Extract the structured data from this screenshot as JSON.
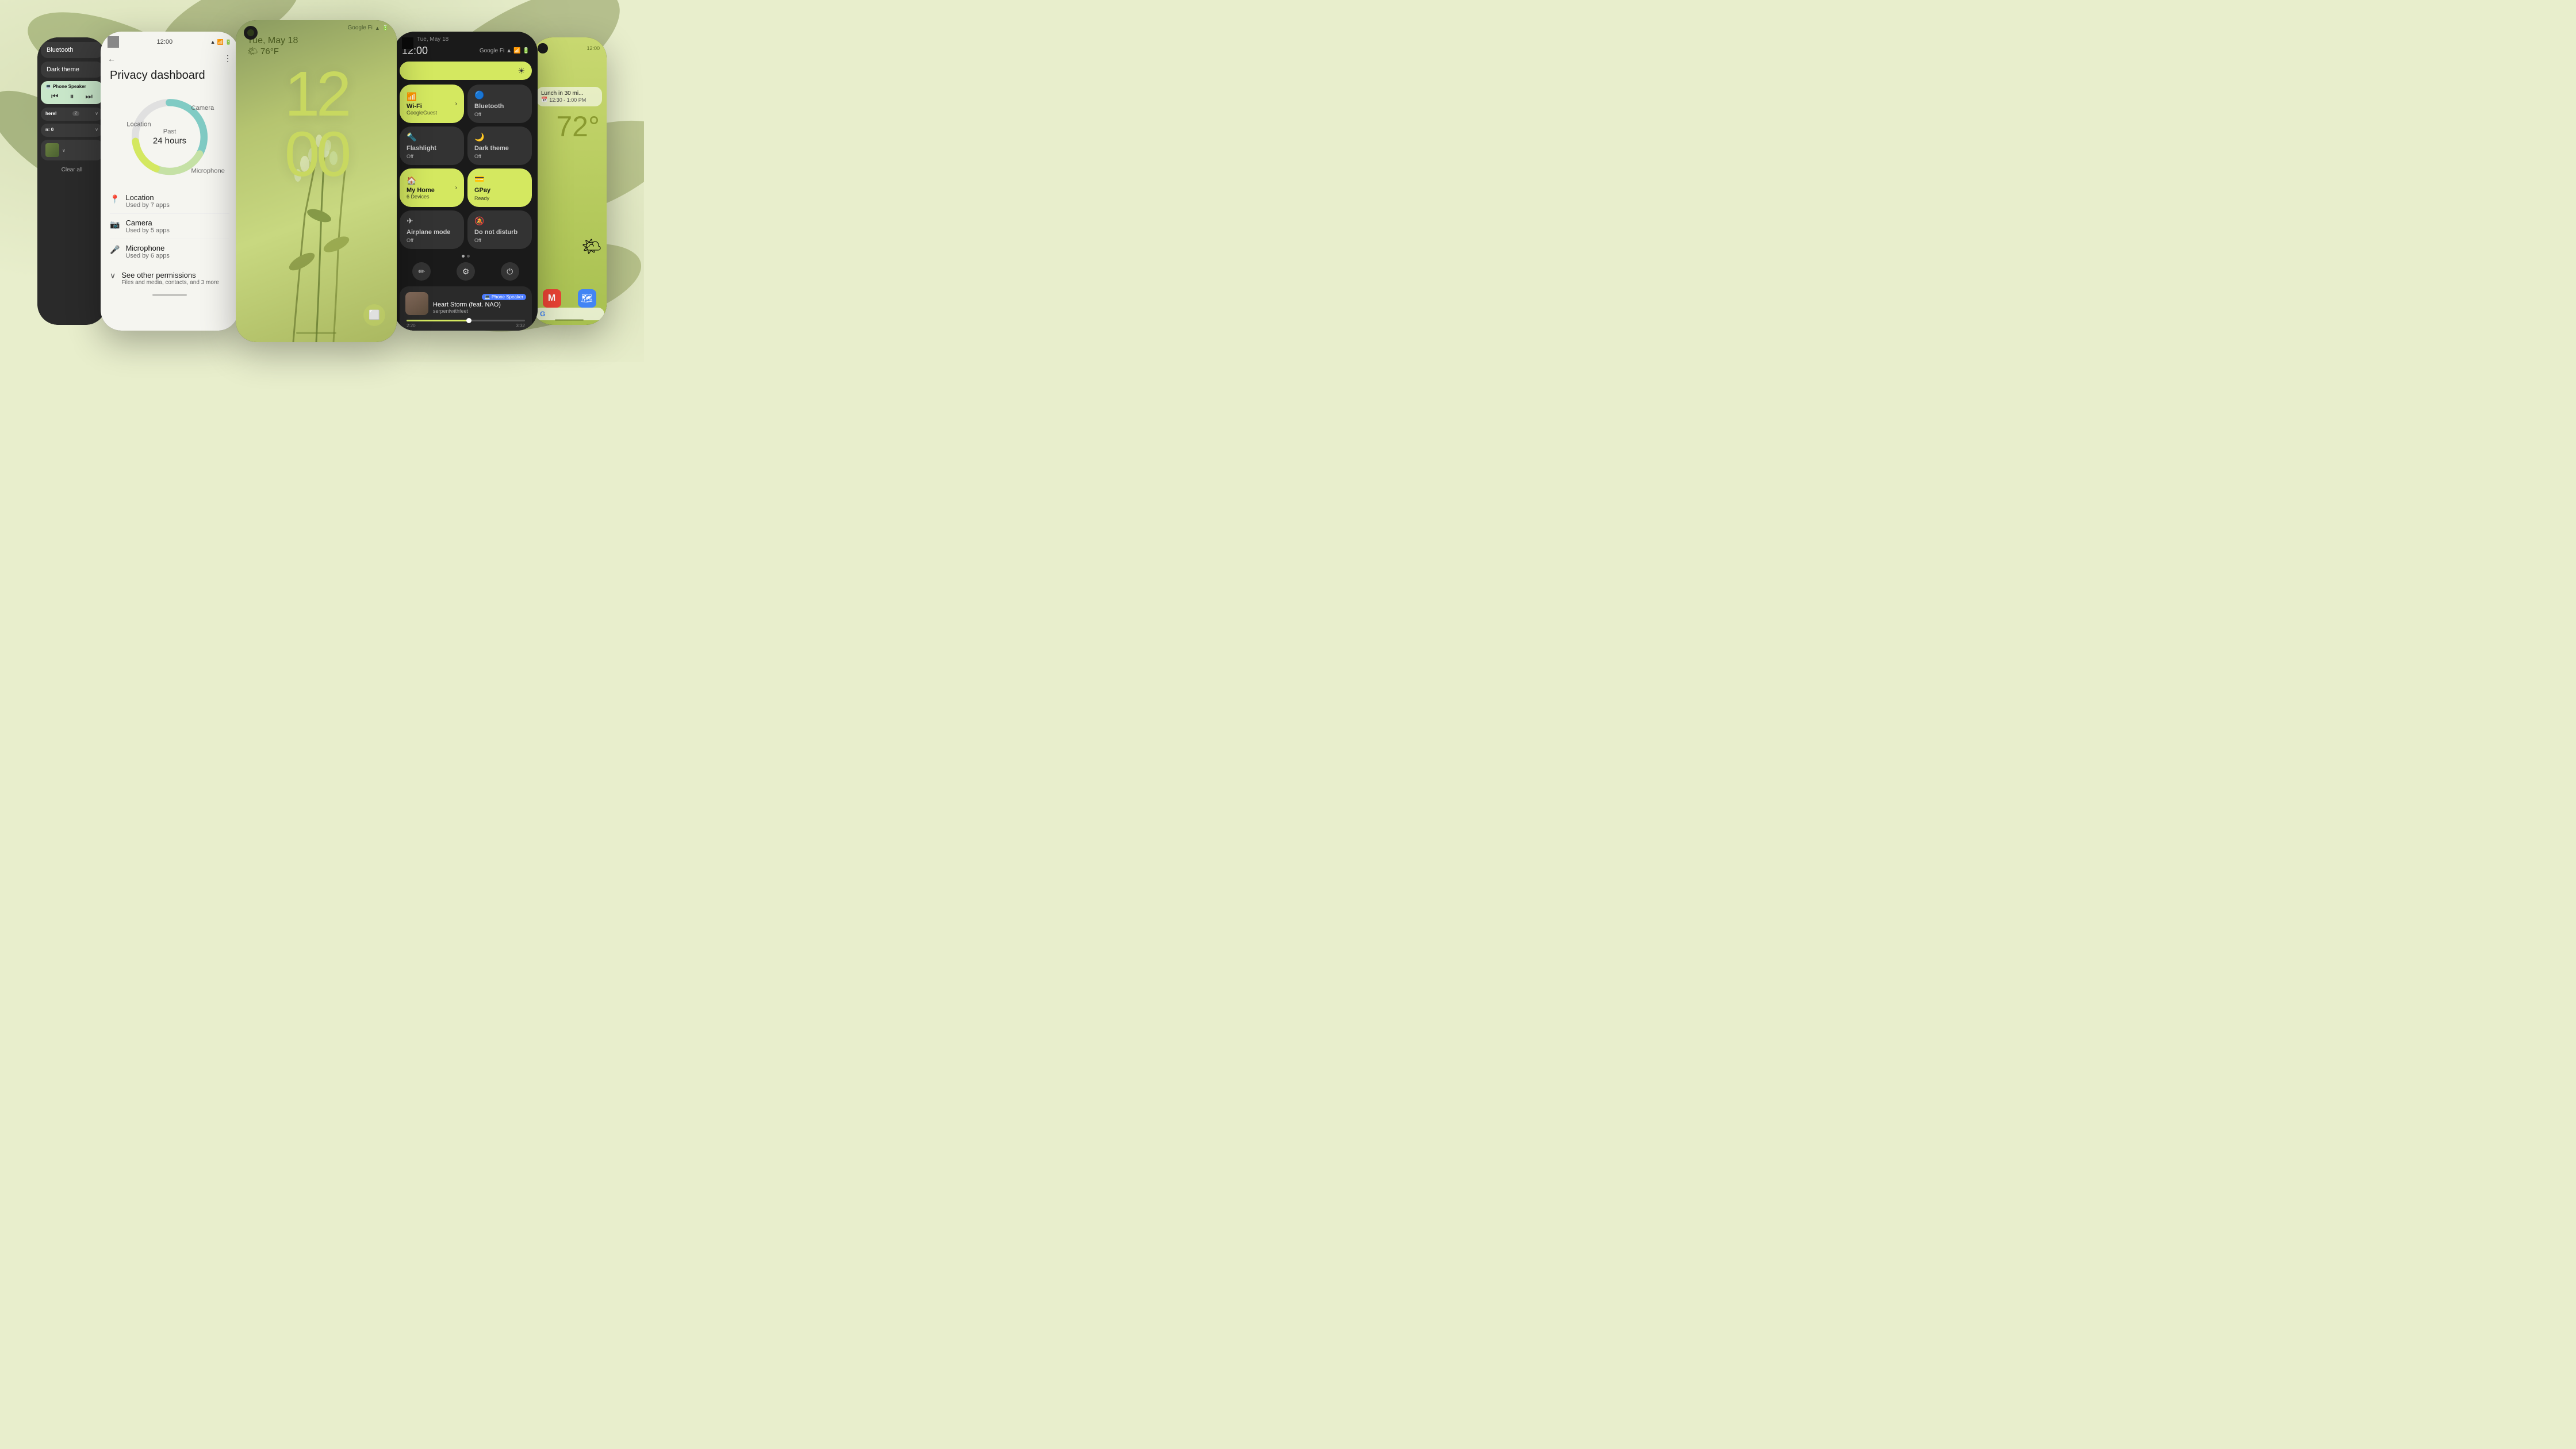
{
  "background": {
    "color": "#e8eecc"
  },
  "phone1": {
    "tiles": [
      {
        "label": "Bluetooth",
        "active": false
      },
      {
        "label": "Dark theme",
        "active": false
      }
    ],
    "media_badge": "Phone Speaker",
    "media_controls": [
      "⏮",
      "⏸",
      "⏭"
    ],
    "notifications": [
      {
        "title": "here!",
        "badge": "2",
        "expand": "∨"
      },
      {
        "body": "n: 0",
        "expand": "∨"
      },
      {
        "expand": "∨",
        "has_image": true
      }
    ],
    "clear_all": "Clear all"
  },
  "phone2": {
    "time": "12:00",
    "title": "Privacy dashboard",
    "chart_center_line1": "Past",
    "chart_center_line2": "24 hours",
    "chart_labels": [
      "Location",
      "Camera",
      "Microphone"
    ],
    "items": [
      {
        "icon": "📍",
        "title": "Location",
        "sub": "Used by 7 apps"
      },
      {
        "icon": "📷",
        "title": "Camera",
        "sub": "Used by 5 apps"
      },
      {
        "icon": "🎤",
        "title": "Microphone",
        "sub": "Used by 6 apps"
      }
    ],
    "see_other": {
      "title": "See other permissions",
      "sub": "Files and media, contacts, and 3 more"
    }
  },
  "phone3": {
    "carrier": "Google Fi",
    "date": "Tue, May 18",
    "weather": "🌤 76°F",
    "time": "12",
    "time2": "00",
    "bottom_btn": "⬜"
  },
  "phone4": {
    "date": "Tue, May 18",
    "time": "12:00",
    "carrier": "Google Fi",
    "tiles": [
      {
        "icon": "📶",
        "label": "Wi-Fi",
        "sub": "GoogleGuest",
        "active": true,
        "arrow": true
      },
      {
        "icon": "🔵",
        "label": "Bluetooth",
        "sub": "Off",
        "active": false
      },
      {
        "icon": "🔦",
        "label": "Flashlight",
        "sub": "Off",
        "active": false
      },
      {
        "icon": "🌙",
        "label": "Dark theme",
        "sub": "Off",
        "active": false
      },
      {
        "icon": "🏠",
        "label": "My Home",
        "sub": "6 Devices",
        "active": true,
        "arrow": true
      },
      {
        "icon": "💳",
        "label": "GPay",
        "sub": "Ready",
        "active": true
      },
      {
        "icon": "✈",
        "label": "Airplane mode",
        "sub": "Off",
        "active": false
      },
      {
        "icon": "🔕",
        "label": "Do not disturb",
        "sub": "Off",
        "active": false
      }
    ],
    "bottom_icons": [
      "✏",
      "⚙",
      "⏻"
    ],
    "media": {
      "source": "Phone Speaker",
      "title": "Heart Storm (feat. NAO)",
      "artist": "serpentwithfeet",
      "time_current": "2:20",
      "time_total": "3:32"
    }
  },
  "phone5": {
    "time": "12:00",
    "event_title": "Lunch in 30 mi...",
    "event_time": "12:30 - 1:00 PM",
    "temperature": "72°",
    "apps": [
      "M",
      "Maps"
    ]
  }
}
